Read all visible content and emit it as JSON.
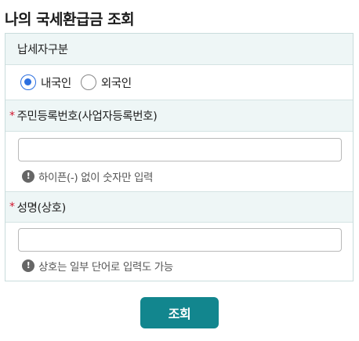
{
  "title": "나의 국세환급금 조회",
  "form": {
    "taxpayer_type": {
      "label": "납세자구분",
      "options": [
        {
          "label": "내국인",
          "selected": true
        },
        {
          "label": "외국인",
          "selected": false
        }
      ]
    },
    "resident_number": {
      "required_mark": "*",
      "label": "주민등록번호(사업자등록번호)",
      "value": "",
      "hint": "하이픈(-) 없이 숫자만 입력"
    },
    "name": {
      "required_mark": "*",
      "label": "성명(상호)",
      "value": "",
      "hint": "상호는 일부 단어로 입력도 가능"
    }
  },
  "submit_label": "조회",
  "hint_icon_glyph": "!",
  "colors": {
    "accent": "#12868e",
    "radio_selected": "#2b6fe0",
    "required": "#d0142c",
    "section_bg": "#eef6f6"
  }
}
